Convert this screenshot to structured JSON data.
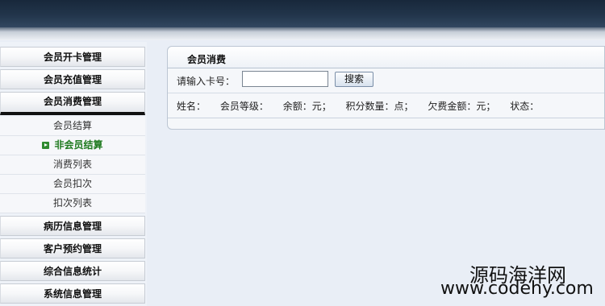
{
  "sidebar": {
    "menus_top": [
      {
        "label": "会员开卡管理"
      },
      {
        "label": "会员充值管理"
      },
      {
        "label": "会员消费管理"
      }
    ],
    "submenu": [
      {
        "label": "会员结算"
      },
      {
        "label": "非会员结算"
      },
      {
        "label": "消费列表"
      },
      {
        "label": "会员扣次"
      },
      {
        "label": "扣次列表"
      }
    ],
    "menus_bottom": [
      {
        "label": "病历信息管理"
      },
      {
        "label": "客户预约管理"
      },
      {
        "label": "综合信息统计"
      },
      {
        "label": "系统信息管理"
      }
    ]
  },
  "panel": {
    "title": "会员消费",
    "search": {
      "label": "请输入卡号：",
      "value": "",
      "button": "搜索"
    },
    "info": {
      "name": "姓名：",
      "level": "会员等级：",
      "balance": "余额：元；",
      "points": "积分数量：点；",
      "arrears": "欠费金额：元；",
      "status": "状态："
    }
  },
  "watermark": {
    "text_cn": "源码海洋网",
    "url": "www.codehy.com"
  },
  "colors": {
    "topbar": "#1c2d41",
    "accent_active": "#1f7a1f",
    "background": "#e9eef6"
  }
}
